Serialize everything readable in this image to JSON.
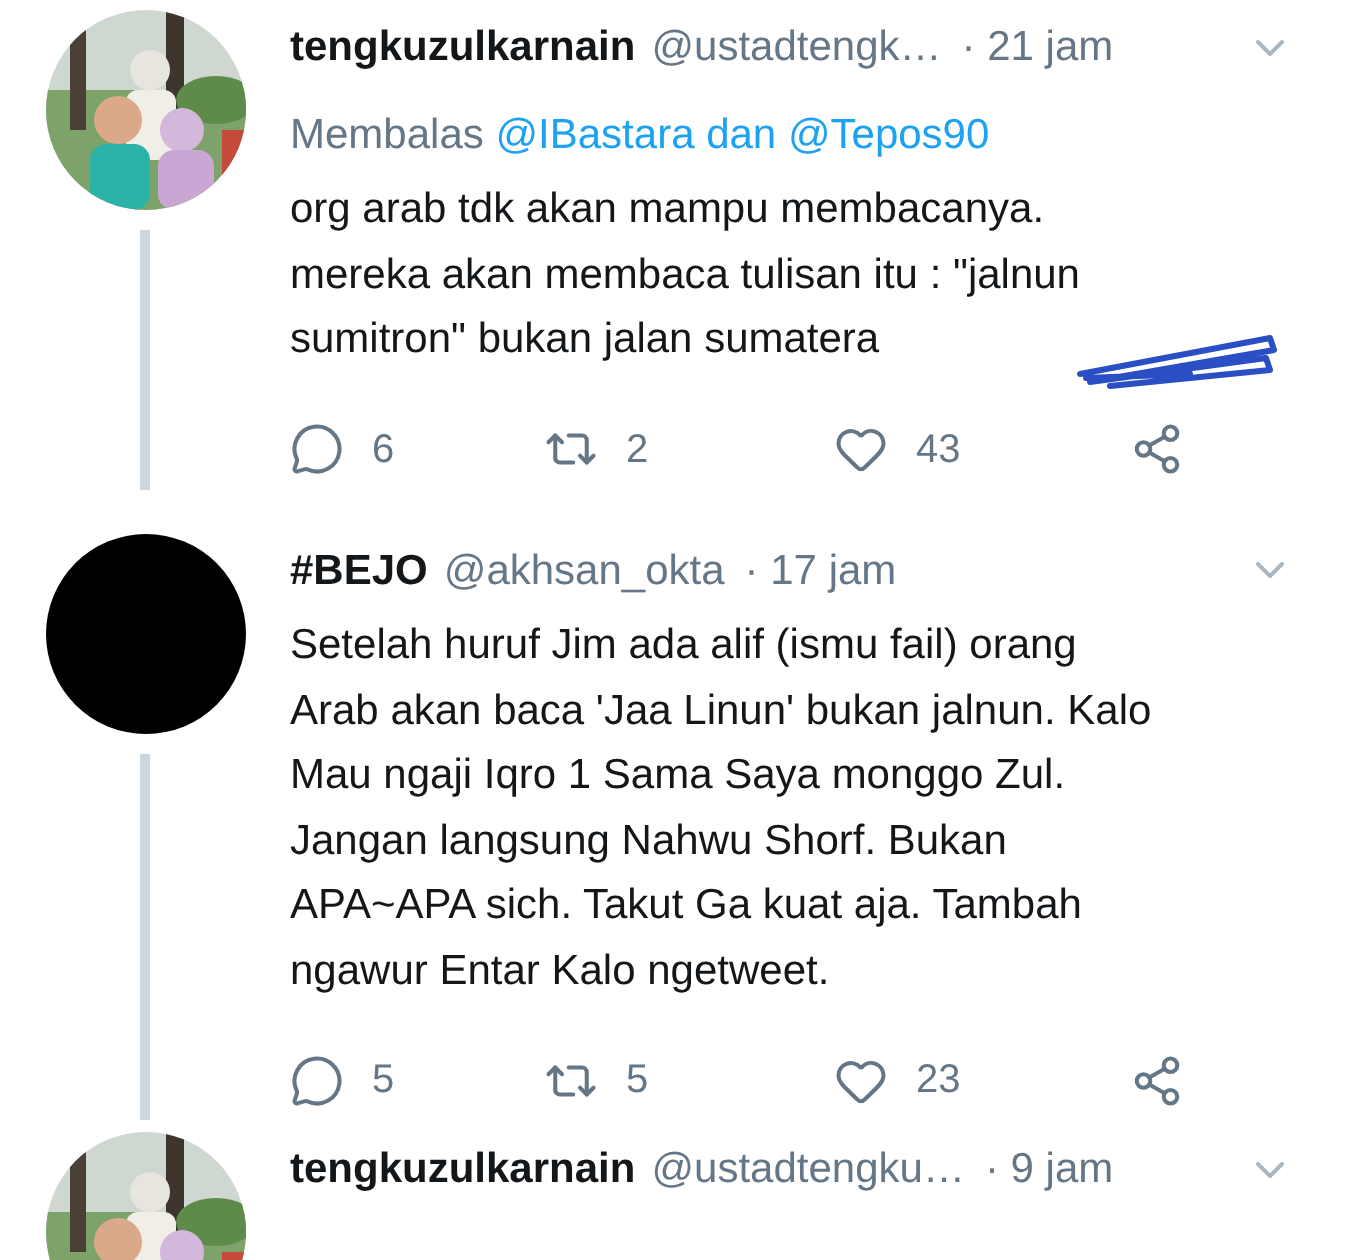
{
  "tweets": [
    {
      "name": "tengkuzulkarnain",
      "handle": "@ustadtengk…",
      "time": "· 21 jam",
      "reply_label": "Membalas",
      "reply_targets": "@IBastara dan @Tepos90",
      "body_lines": [
        "org arab tdk akan mampu membacanya.",
        "mereka akan membaca tulisan itu : \"jalnun",
        "sumitron\" bukan jalan sumatera"
      ],
      "scribble": true,
      "replies": "6",
      "retweets": "2",
      "likes": "43"
    },
    {
      "avatar": {
        "kind": "plain"
      },
      "name": "#BEJO",
      "handle": "@akhsan_okta",
      "time": "· 17 jam",
      "body_lines": [
        "Setelah huruf Jim ada alif (ismu fail) orang",
        "Arab akan baca 'Jaa Linun' bukan jalnun. Kalo",
        "Mau ngaji Iqro 1 Sama Saya monggo Zul.",
        "Jangan langsung Nahwu Shorf. Bukan",
        "APA~APA sich. Takut Ga kuat aja. Tambah",
        "ngawur Entar Kalo ngetweet."
      ],
      "replies": "5",
      "retweets": "5",
      "likes": "23"
    },
    {
      "name": "tengkuzulkarnain",
      "handle": "@ustadtengku…",
      "time": "· 9 jam"
    }
  ]
}
